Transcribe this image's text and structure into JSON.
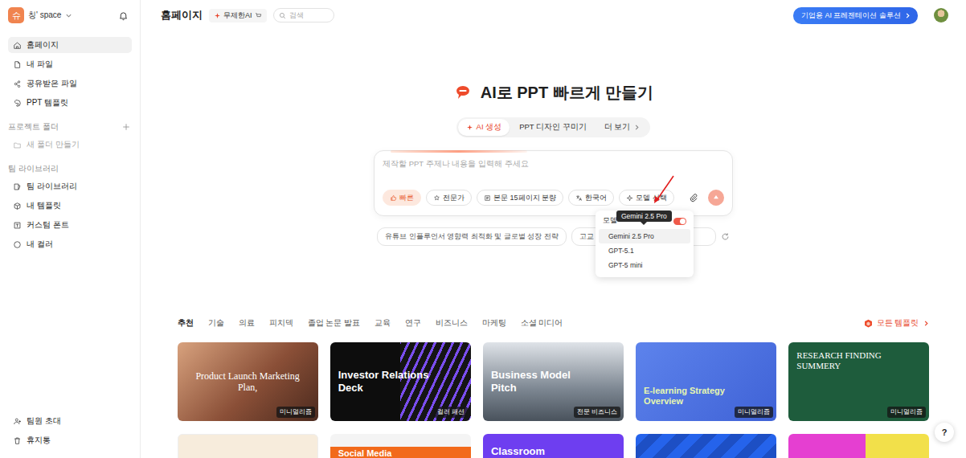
{
  "sidebar": {
    "workspace": {
      "avatar": "슈",
      "name": "칭' space"
    },
    "items": [
      {
        "label": "홈페이지",
        "selected": true
      },
      {
        "label": "내 파일",
        "selected": false
      },
      {
        "label": "공유받은 파일",
        "selected": false
      },
      {
        "label": "PPT 템플릿",
        "selected": false
      }
    ],
    "sections": [
      {
        "title": "프로젝트 폴더",
        "items": [
          {
            "label": "새 폴더 만들기",
            "disabled": true
          }
        ]
      },
      {
        "title": "팀 라이브러리",
        "items": [
          {
            "label": "팀 라이브러리",
            "disabled": false
          },
          {
            "label": "내 템플릿",
            "disabled": false
          },
          {
            "label": "커스텀 폰트",
            "disabled": false
          },
          {
            "label": "내 컬러",
            "disabled": false
          }
        ]
      }
    ],
    "footer": [
      {
        "label": "팀원 초대"
      },
      {
        "label": "휴지통"
      }
    ]
  },
  "header": {
    "title": "홈페이지",
    "badge": "무제한AI",
    "search": {
      "placeholder": "검색"
    },
    "cta": "기업용 AI 프레젠테이션 솔루션"
  },
  "hero": {
    "title": "AI로 PPT 빠르게 만들기",
    "modes": [
      {
        "label": "AI 생성",
        "selected": true
      },
      {
        "label": "PPT 디자인 꾸미기",
        "selected": false
      },
      {
        "label": "더 보기",
        "selected": false
      }
    ],
    "prompt": {
      "placeholder": "제작할 PPT 주제나 내용을 입력해 주세요"
    },
    "options": [
      {
        "label": "빠른",
        "selected": true
      },
      {
        "label": "전문가",
        "selected": false
      },
      {
        "label": "본문 15페이지 분량",
        "selected": false
      },
      {
        "label": "한국어",
        "selected": false
      },
      {
        "label": "모델 선택",
        "selected": false
      }
    ],
    "send": {
      "disabled": true
    },
    "model_menu": {
      "header": "모델",
      "toggle_on": true,
      "tooltip": "Gemini 2.5 Pro",
      "items": [
        {
          "label": "Gemini 2.5 Pro",
          "selected": true
        },
        {
          "label": "GPT-5.1",
          "selected": false
        },
        {
          "label": "GPT-5 mini",
          "selected": false
        }
      ]
    },
    "suggestions": [
      "유튜브 인플루언서 영향력 최적화 및 글로벌 성장 전략",
      "고교 교육 프로"
    ]
  },
  "gallery": {
    "categories": [
      {
        "label": "추천",
        "selected": true
      },
      {
        "label": "기술",
        "selected": false
      },
      {
        "label": "의료",
        "selected": false
      },
      {
        "label": "피치덱",
        "selected": false
      },
      {
        "label": "졸업 논문 발표",
        "selected": false
      },
      {
        "label": "교육",
        "selected": false
      },
      {
        "label": "연구",
        "selected": false
      },
      {
        "label": "비즈니스",
        "selected": false
      },
      {
        "label": "마케팅",
        "selected": false
      },
      {
        "label": "소셜 미디어",
        "selected": false
      }
    ],
    "all_templates": "모든 템플릿",
    "templates": [
      {
        "kind": "warm",
        "title": "Product Launch Marketing Plan,",
        "badge": "미니멀리즘"
      },
      {
        "kind": "stripes",
        "title": "Investor Relations Deck",
        "badge": "컬러 패션"
      },
      {
        "kind": "city",
        "title": "Business Model Pitch",
        "badge": "전문 비즈니스"
      },
      {
        "kind": "elearning",
        "title": "E-learning Strategy Overview",
        "badge": "미니멀리즘"
      },
      {
        "kind": "research",
        "title": "RESEARCH FINDING SUMMERY",
        "badge": "미니멀리즘"
      },
      {
        "kind": "beige"
      },
      {
        "kind": "social",
        "title": "Social Media"
      },
      {
        "kind": "classroom",
        "title": "Classroom"
      },
      {
        "kind": "blue"
      },
      {
        "kind": "magenta"
      }
    ]
  },
  "help": "?"
}
